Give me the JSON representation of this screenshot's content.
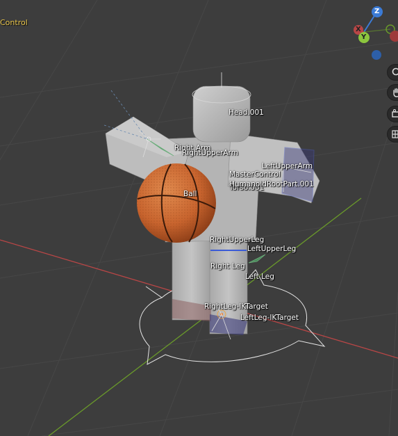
{
  "viewport": {
    "mode_label": "Control",
    "gizmo": {
      "z": "Z",
      "y": "Y",
      "x": "X"
    }
  },
  "nav_buttons": [
    "zoom-icon",
    "hand-pan-icon",
    "camera-icon",
    "grid-icon"
  ],
  "colors": {
    "background": "#3d3d3d",
    "x_axis": "#b84646",
    "y_axis": "#6a9a2a",
    "z_axis": "#3b7bd6",
    "mode_text": "#e8c44a",
    "ball": "#c8642e",
    "body": "#b9b9b9"
  },
  "bone_labels": {
    "head": "Head.001",
    "right_arm": "Right Arm",
    "right_upper_arm": "RightUpperArm",
    "left_upper_arm": "LeftUpperArm",
    "master_control": "MasterControl",
    "humanoid_root": "HumanoidRootPart.001",
    "torso": "Torso.001",
    "ball": "Ball",
    "right_upper_leg": "RightUpperLeg",
    "left_upper_leg": "LeftUpperLeg",
    "right_leg": "Right Leg",
    "left_leg": "Left Leg",
    "right_leg_ik": "RightLeg-IKTarget",
    "left_leg_ik": "LeftLeg-IKTarget"
  }
}
